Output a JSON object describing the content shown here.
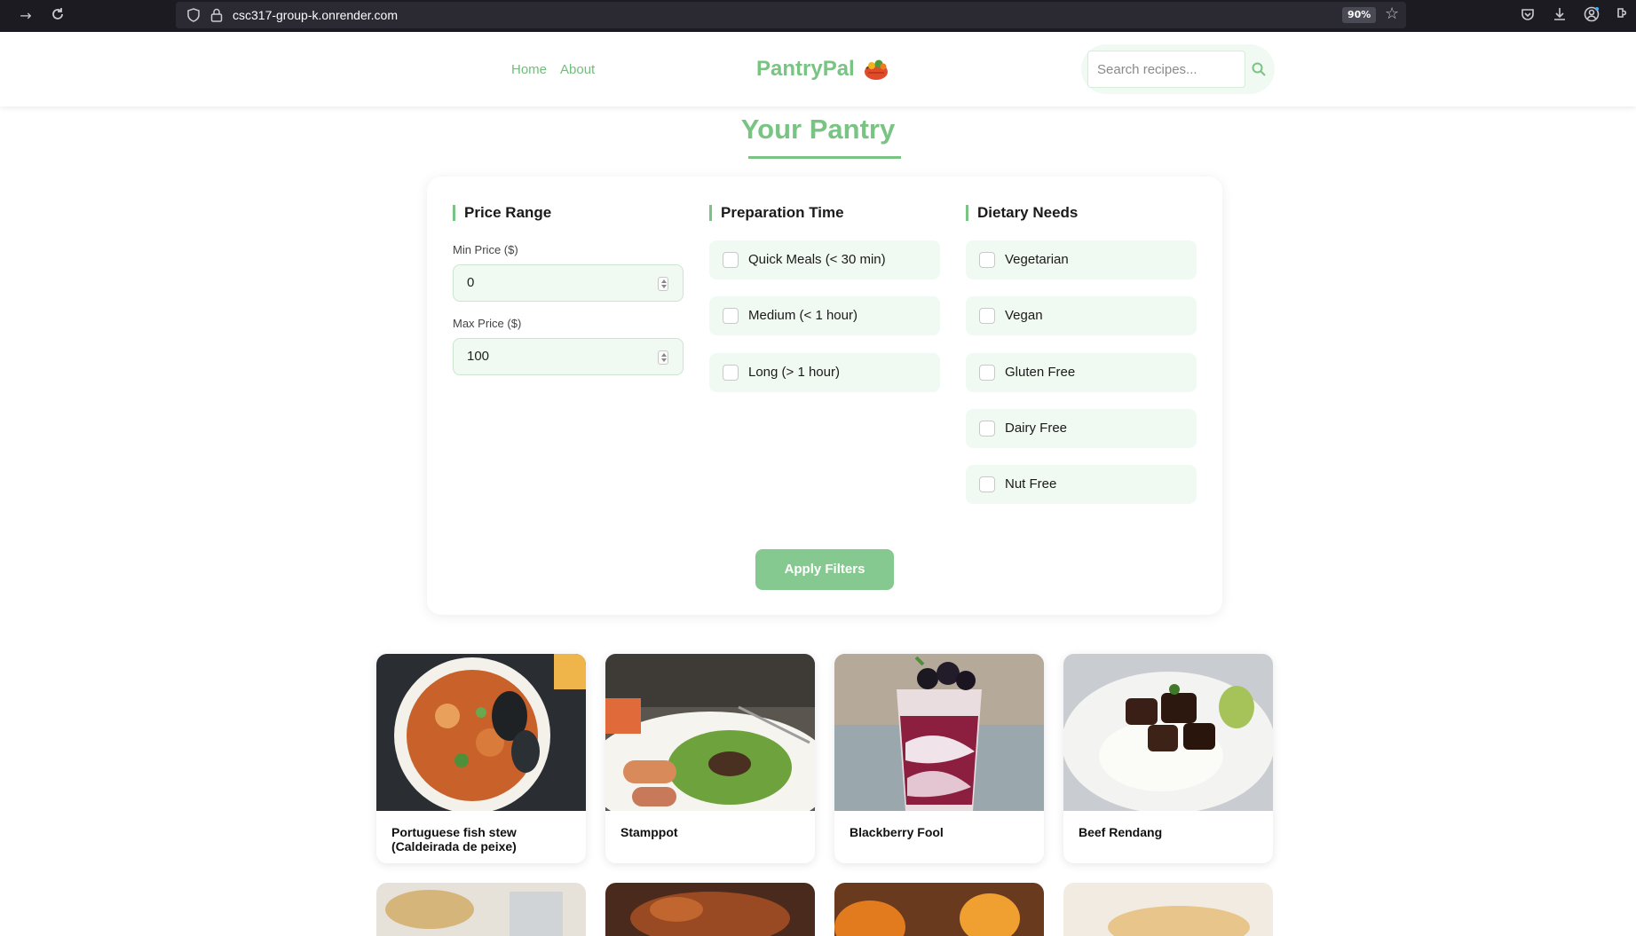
{
  "browser": {
    "url": "csc317-group-k.onrender.com",
    "zoom": "90%"
  },
  "header": {
    "nav": [
      {
        "label": "Home"
      },
      {
        "label": "About"
      }
    ],
    "brand": "PantryPal",
    "search_placeholder": "Search recipes..."
  },
  "page_title": "Your Pantry",
  "filters": {
    "price": {
      "heading": "Price Range",
      "min_label": "Min Price ($)",
      "min_value": "0",
      "max_label": "Max Price ($)",
      "max_value": "100"
    },
    "prep": {
      "heading": "Preparation Time",
      "options": [
        "Quick Meals (< 30 min)",
        "Medium (< 1 hour)",
        "Long (> 1 hour)"
      ]
    },
    "diet": {
      "heading": "Dietary Needs",
      "options": [
        "Vegetarian",
        "Vegan",
        "Gluten Free",
        "Dairy Free",
        "Nut Free"
      ]
    },
    "apply_label": "Apply Filters"
  },
  "recipes": [
    {
      "name": "Portuguese fish stew (Caldeirada de peixe)"
    },
    {
      "name": "Stamppot"
    },
    {
      "name": "Blackberry Fool"
    },
    {
      "name": "Beef Rendang"
    }
  ],
  "colors": {
    "accent": "#79c383",
    "panel_bg": "#f1faf2",
    "button": "#86c990",
    "chrome": "#1c1b22"
  }
}
